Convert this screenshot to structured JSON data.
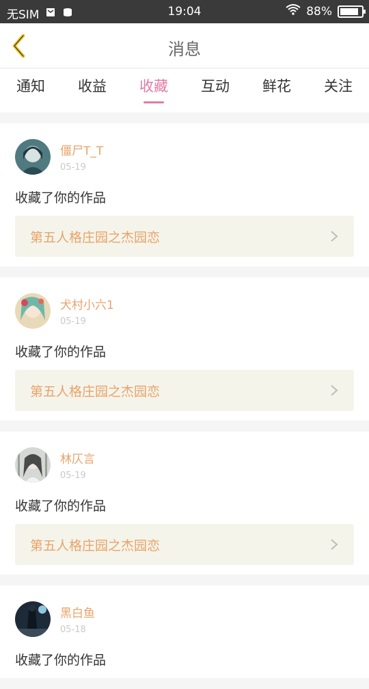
{
  "status": {
    "carrier": "无SIM",
    "time": "19:04",
    "battery": "88%",
    "battery_level": 0.88
  },
  "header": {
    "title": "消息"
  },
  "tabs": [
    {
      "label": "通知"
    },
    {
      "label": "收益"
    },
    {
      "label": "收藏",
      "active": true
    },
    {
      "label": "互动"
    },
    {
      "label": "鲜花"
    },
    {
      "label": "关注"
    }
  ],
  "items": [
    {
      "name": "僵尸T_T",
      "date": "05-19",
      "message": "收藏了你的作品",
      "work": "第五人格庄园之杰园恋"
    },
    {
      "name": "犬村小六1",
      "date": "05-19",
      "message": "收藏了你的作品",
      "work": "第五人格庄园之杰园恋"
    },
    {
      "name": "林仄言",
      "date": "05-19",
      "message": "收藏了你的作品",
      "work": "第五人格庄园之杰园恋"
    },
    {
      "name": "黑白鱼",
      "date": "05-18",
      "message": "收藏了你的作品",
      "work": ""
    }
  ],
  "colors": {
    "accent": "#e17aa6",
    "name": "#e9a36a",
    "back": "#f0c93a"
  }
}
